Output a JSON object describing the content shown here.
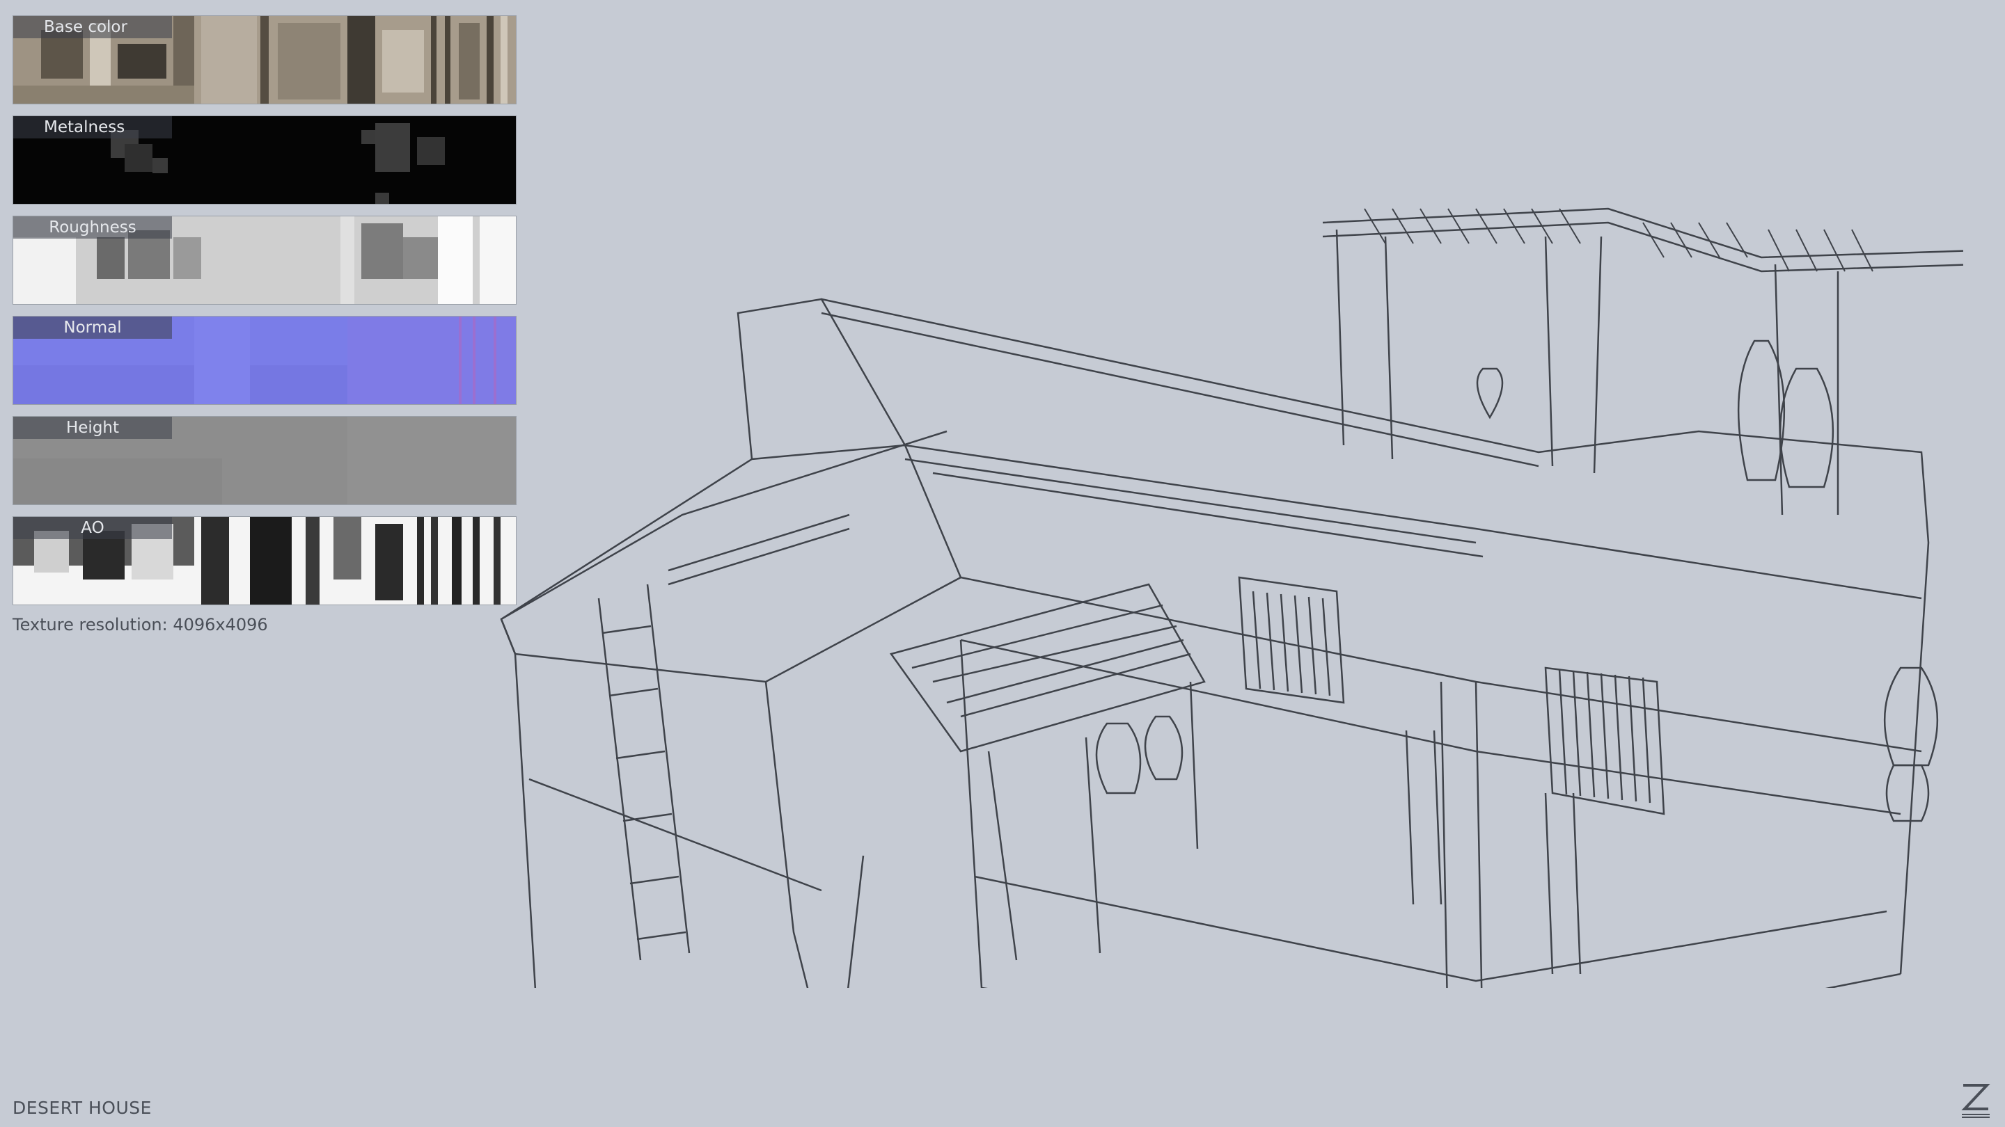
{
  "textures": [
    {
      "label": "Base color",
      "key": "base"
    },
    {
      "label": "Metalness",
      "key": "metal"
    },
    {
      "label": "Roughness",
      "key": "rough"
    },
    {
      "label": "Normal",
      "key": "normal"
    },
    {
      "label": "Height",
      "key": "height"
    },
    {
      "label": "AO",
      "key": "ao"
    }
  ],
  "resolution_text": "Texture resolution: 4096x4096",
  "model_title": "DESERT HOUSE",
  "logo_icon": "z-logo-icon",
  "colors": {
    "background": "#c6cbd4",
    "wireframe": "#3f434a",
    "normal_map": "#7a7de8",
    "metalness": "#050505",
    "height": "#8d8d8d"
  }
}
